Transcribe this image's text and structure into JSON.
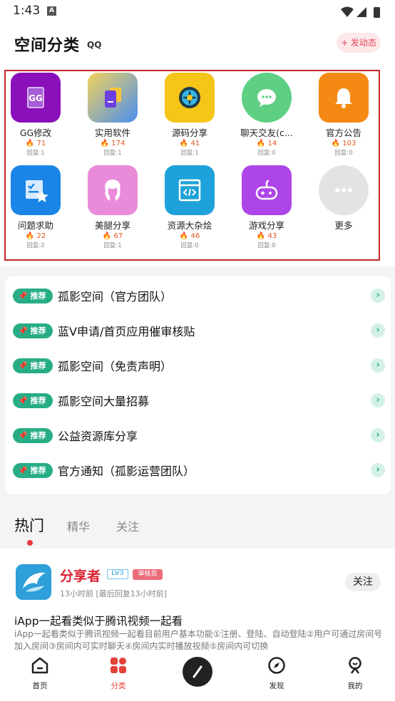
{
  "status_bar": {
    "time": "1:43",
    "notification_icon": "A"
  },
  "header": {
    "title": "空间分类",
    "badge": "QQ",
    "post_button": "+ 发动态"
  },
  "categories": [
    {
      "name": "GG修改",
      "hot": "71",
      "reply": "回复:1",
      "icon": "gg-icon",
      "color": "#8a10b9"
    },
    {
      "name": "实用软件",
      "hot": "174",
      "reply": "回复:1",
      "icon": "phone-card-icon",
      "color": "#f3c54b"
    },
    {
      "name": "源码分享",
      "hot": "41",
      "reply": "回复:1",
      "icon": "wheel-icon",
      "color": "#f5c517"
    },
    {
      "name": "聊天交友(c...",
      "hot": "14",
      "reply": "回复:0",
      "icon": "chat-bubble-icon",
      "color": "#5fcf83"
    },
    {
      "name": "官方公告",
      "hot": "103",
      "reply": "回复:0",
      "icon": "bell-icon",
      "color": "#f48a13"
    },
    {
      "name": "问题求助",
      "hot": "22",
      "reply": "回复:2",
      "icon": "checklist-star-icon",
      "color": "#1a85e6"
    },
    {
      "name": "美腿分享",
      "hot": "67",
      "reply": "回复:1",
      "icon": "girl-icon",
      "color": "#e98bd9"
    },
    {
      "name": "资源大杂烩",
      "hot": "46",
      "reply": "回复:0",
      "icon": "code-window-icon",
      "color": "#1fa2d9"
    },
    {
      "name": "游戏分享",
      "hot": "43",
      "reply": "回复:0",
      "icon": "gamepad-icon",
      "color": "#ae45e8"
    },
    {
      "name": "更多",
      "hot": "",
      "reply": "",
      "icon": "more-dots-icon",
      "color": "#e3e3e3"
    }
  ],
  "recommend": {
    "tag_label": "推荐",
    "items": [
      "孤影空间（官方团队）",
      "蓝V申请/首页应用催审核贴",
      "孤影空间（免责声明）",
      "孤影空间大量招募",
      "公益资源库分享",
      "官方通知（孤影运营团队）"
    ]
  },
  "tabs": {
    "hot": "热门",
    "featured": "精华",
    "follow": "关注"
  },
  "post": {
    "author": "分享者",
    "level": "LV3",
    "role": "审核员",
    "time": "13小时前 [最后回复13小时前]",
    "follow_label": "关注",
    "title": "iApp一起看类似于腾讯视频一起看",
    "body": "iApp一起看类似于腾讯视频一起看目前用户基本功能①注册、登陆、自动登陆②用户可通过房间号加入房间③房间内可实时聊天④房间内实时播放视频⑤房间内可切换"
  },
  "bottom_nav": {
    "home": "首页",
    "category": "分类",
    "discover": "发现",
    "mine": "我的"
  },
  "colors": {
    "accent_red": "#e4413a",
    "recommend_green": "#27ad85",
    "outline_red": "#c8252b"
  }
}
